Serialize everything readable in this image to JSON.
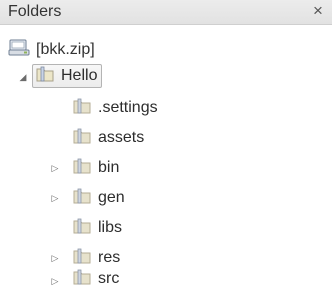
{
  "panel": {
    "title": "Folders",
    "close_glyph": "×"
  },
  "tree": {
    "root": {
      "label": "[bkk.zip]",
      "icon": "archive-drive-icon"
    },
    "project": {
      "label": "Hello",
      "icon": "folder-icon",
      "expanded": true,
      "selected": true
    },
    "children": [
      {
        "label": ".settings",
        "icon": "folder-icon",
        "expandable": false
      },
      {
        "label": "assets",
        "icon": "folder-icon",
        "expandable": false
      },
      {
        "label": "bin",
        "icon": "folder-icon",
        "expandable": true
      },
      {
        "label": "gen",
        "icon": "folder-icon",
        "expandable": true
      },
      {
        "label": "libs",
        "icon": "folder-icon",
        "expandable": false
      },
      {
        "label": "res",
        "icon": "folder-icon",
        "expandable": true
      },
      {
        "label": "src",
        "icon": "folder-icon",
        "expandable": true
      }
    ]
  }
}
